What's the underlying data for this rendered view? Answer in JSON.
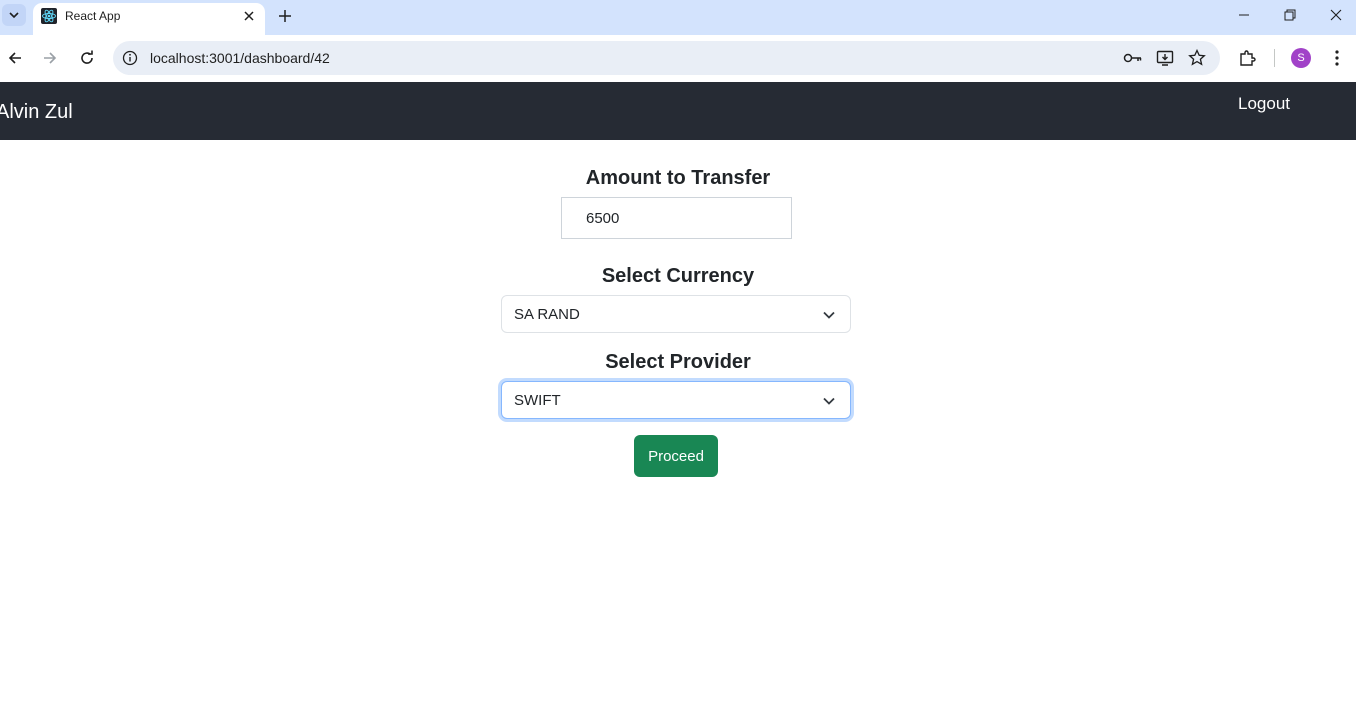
{
  "browser": {
    "tab_title": "React App",
    "url": "localhost:3001/dashboard/42",
    "profile_initial": "S"
  },
  "navbar": {
    "brand": "Alvin Zul",
    "logout_label": "Logout"
  },
  "form": {
    "amount_label": "Amount to Transfer",
    "amount_value": "6500",
    "currency_label": "Select Currency",
    "currency_value": "SA RAND",
    "provider_label": "Select Provider",
    "provider_value": "SWIFT",
    "proceed_label": "Proceed"
  },
  "colors": {
    "navbar_bg": "#262b34",
    "proceed_bg": "#198754",
    "tabbar_bg": "#d3e3fd",
    "focus_ring": "#86b7fe"
  }
}
